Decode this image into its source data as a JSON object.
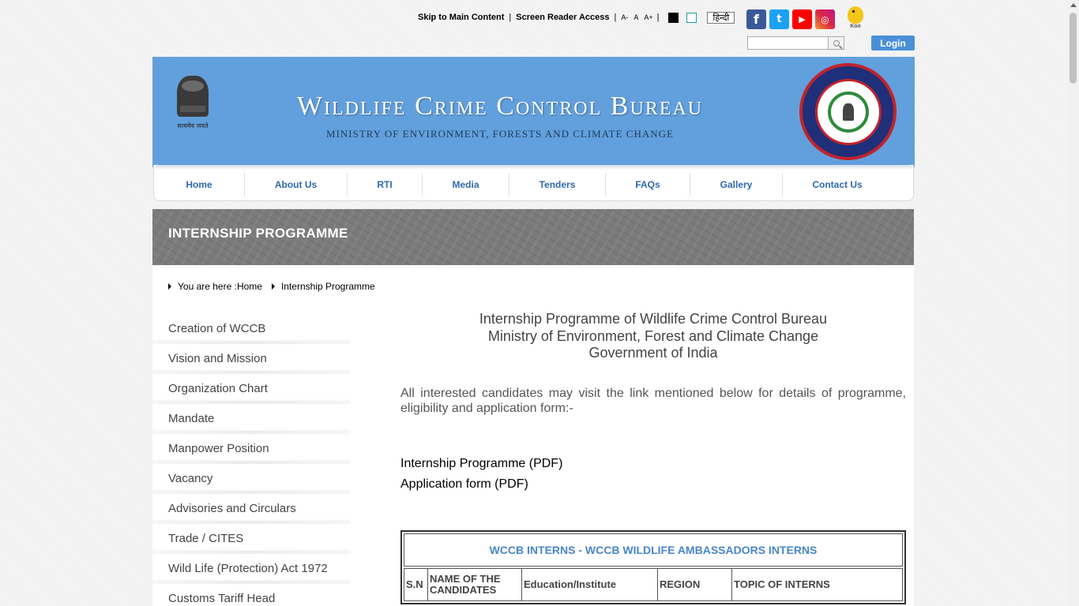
{
  "topbar": {
    "skip_link": "Skip to Main Content",
    "separator": "|",
    "screen_reader": "Screen Reader Access",
    "font_decrease": "A-",
    "font_normal": "A",
    "font_increase": "A+",
    "language": "हिन्दी"
  },
  "social": {
    "facebook_icon": "f",
    "twitter_icon": "t",
    "youtube_icon": "▶",
    "instagram_icon": "◎",
    "koo_label": "Koo"
  },
  "login": {
    "label": "Login"
  },
  "search": {
    "placeholder": ""
  },
  "header": {
    "title": "Wildlife Crime Control Bureau",
    "subtitle": "Ministry of Environment, Forests and Climate Change",
    "emblem_motto": "सत्यमेव जयते",
    "seal_top": "WILDLIFE CRIME CONTROL BUREAU",
    "seal_bottom": "GOVERNMENT OF INDIA"
  },
  "nav": {
    "items": [
      {
        "label": "Home"
      },
      {
        "label": "About Us"
      },
      {
        "label": "RTI"
      },
      {
        "label": "Media"
      },
      {
        "label": "Tenders"
      },
      {
        "label": "FAQs"
      },
      {
        "label": "Gallery"
      },
      {
        "label": "Contact Us"
      }
    ]
  },
  "banner": {
    "title": "INTERNSHIP PROGRAMME"
  },
  "breadcrumb": {
    "prefix": "You are here :",
    "home": "Home",
    "current": "Internship Programme"
  },
  "sidebar": {
    "items": [
      {
        "label": "Creation of WCCB"
      },
      {
        "label": "Vision and Mission"
      },
      {
        "label": "Organization Chart"
      },
      {
        "label": "Mandate"
      },
      {
        "label": "Manpower Position"
      },
      {
        "label": "Vacancy"
      },
      {
        "label": "Advisories and Circulars"
      },
      {
        "label": "Trade / CITES"
      },
      {
        "label": "Wild Life (Protection) Act 1972"
      },
      {
        "label": "Customs Tariff Head"
      }
    ]
  },
  "main": {
    "heading_line1": "Internship Programme of Wildlife Crime Control Bureau",
    "heading_line2": "Ministry of Environment, Forest and Climate Change",
    "heading_line3": "Government of India",
    "intro": "All interested candidates may visit the link mentioned below for details of programme, eligibility and application form:-",
    "link_programme": "Internship Programme (PDF)",
    "link_application": "Application form (PDF)"
  },
  "table": {
    "title": "WCCB INTERNS - WCCB WILDLIFE AMBASSADORS INTERNS",
    "headers": [
      "S.N",
      "NAME OF THE CANDIDATES",
      "Education/Institute",
      "REGION",
      "TOPIC OF INTERNS"
    ]
  }
}
